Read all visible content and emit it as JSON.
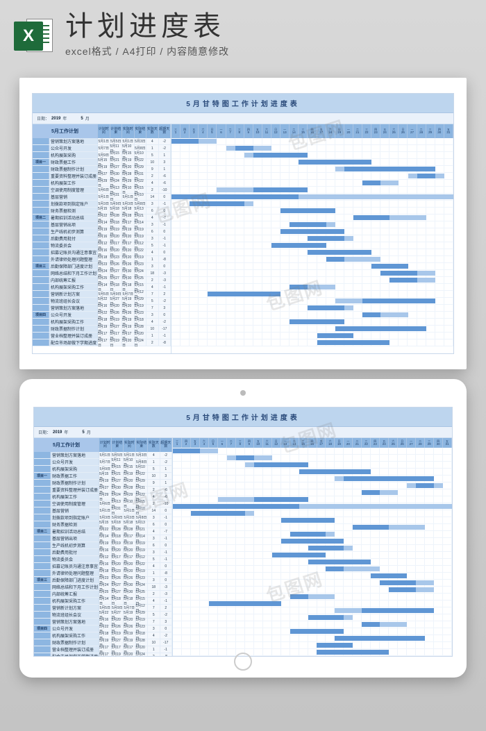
{
  "header": {
    "title": "计划进度表",
    "subtitle": "excel格式 / A4打印 / 内容随意修改",
    "icon_letter": "X"
  },
  "chart_data": {
    "type": "table",
    "title": "5月甘特图工作计划进度表",
    "date_label": "日期：",
    "year": "2019",
    "year_suffix": "年",
    "month": "5",
    "month_suffix": "月",
    "plan_heading": "5月工作计划",
    "columns": [
      "计划时间",
      "计划结束",
      "实际时间",
      "实际结束",
      "实际天数",
      "超期天数"
    ],
    "days": 31,
    "weekdays": [
      "三",
      "四",
      "五",
      "六",
      "日",
      "一",
      "二",
      "三",
      "四",
      "五",
      "六",
      "日",
      "一",
      "二",
      "三",
      "四",
      "五",
      "六",
      "日",
      "一",
      "二",
      "三",
      "四",
      "五",
      "六",
      "日",
      "一",
      "二",
      "三",
      "四",
      "五"
    ],
    "groups": [
      {
        "name": "项目一",
        "tasks": [
          {
            "name": "营销策划方案落地",
            "plan_start": "5月1日",
            "plan_end": "5月5日",
            "actual_start": "5月1日",
            "actual_end": "5月3日",
            "actual_days": 4,
            "over": -2,
            "bar_start": 1,
            "bar_len": 5,
            "abar_start": 1,
            "abar_len": 3
          },
          {
            "name": "公众号开发",
            "plan_start": "5月7日",
            "plan_end": "5月11日",
            "actual_start": "5月10日",
            "actual_end": "5月8日",
            "actual_days": 1,
            "over": -2,
            "bar_start": 7,
            "bar_len": 5,
            "abar_start": 8,
            "abar_len": 2
          },
          {
            "name": "机构展架采购",
            "plan_start": "5月9日",
            "plan_end": "5月15日",
            "actual_start": "5月15日",
            "actual_end": "5月10日",
            "actual_days": 5,
            "over": 1,
            "bar_start": 9,
            "bar_len": 7,
            "abar_start": 10,
            "abar_len": 6
          },
          {
            "name": "财政票据工作",
            "plan_start": "5月15日",
            "plan_end": "5月21日",
            "actual_start": "5月19日",
            "actual_end": "5月22日",
            "actual_days": 10,
            "over": 3,
            "bar_start": 15,
            "bar_len": 7,
            "abar_start": 15,
            "abar_len": 8
          },
          {
            "name": "财政票据制作计划",
            "plan_start": "5月19日",
            "plan_end": "5月27日",
            "actual_start": "5月20日",
            "actual_end": "5月29日",
            "actual_days": 9,
            "over": 1,
            "bar_start": 19,
            "bar_len": 9,
            "abar_start": 20,
            "abar_len": 10
          },
          {
            "name": "重要资料整理并装订成册",
            "plan_start": "5月27日",
            "plan_end": "5月30日",
            "actual_start": "5月28日",
            "actual_end": "5月31日",
            "actual_days": 2,
            "over": -6,
            "bar_start": 27,
            "bar_len": 4,
            "abar_start": 28,
            "abar_len": 2
          },
          {
            "name": "机构展架工作",
            "plan_start": "5月29日",
            "plan_end": "5月24日",
            "actual_start": "5月29日",
            "actual_end": "5月22日",
            "actual_days": 4,
            "over": -6,
            "bar_start": 22,
            "bar_len": 4,
            "abar_start": 22,
            "abar_len": 2
          }
        ]
      },
      {
        "name": "项目二",
        "tasks": [
          {
            "name": "空调使用制度管理",
            "plan_start": "5月6日",
            "plan_end": "5月13日",
            "actual_start": "5月10日",
            "actual_end": "5月15日",
            "actual_days": 2,
            "over": -10,
            "bar_start": 6,
            "bar_len": 8,
            "abar_start": 10,
            "abar_len": 6
          },
          {
            "name": "基层营销",
            "plan_start": "5月1日",
            "plan_end": "5月31日",
            "actual_start": "5月1日",
            "actual_end": "5月10日",
            "actual_days": 14,
            "over": 0,
            "bar_start": 1,
            "bar_len": 31,
            "abar_start": 1,
            "abar_len": 14
          },
          {
            "name": "划拨款项到指定账户",
            "plan_start": "5月3日",
            "plan_end": "5月9日",
            "actual_start": "5月3日",
            "actual_end": "5月8日",
            "actual_days": 3,
            "over": -1,
            "bar_start": 3,
            "bar_len": 7,
            "abar_start": 3,
            "abar_len": 6
          },
          {
            "name": "财务票据检测",
            "plan_start": "5月15日",
            "plan_end": "5月18日",
            "actual_start": "5月18日",
            "actual_end": "5月13日",
            "actual_days": 6,
            "over": 0,
            "bar_start": 13,
            "bar_len": 6,
            "abar_start": 13,
            "abar_len": 6
          },
          {
            "name": "暑期招训活动总结",
            "plan_start": "5月22日",
            "plan_end": "5月28日",
            "actual_start": "5月28日",
            "actual_end": "5月21日",
            "actual_days": 4,
            "over": -7,
            "bar_start": 21,
            "bar_len": 8,
            "abar_start": 21,
            "abar_len": 4
          },
          {
            "name": "基层营销出项",
            "plan_start": "5月14日",
            "plan_end": "5月18日",
            "actual_start": "5月17日",
            "actual_end": "5月14日",
            "actual_days": 3,
            "over": -1,
            "bar_start": 14,
            "bar_len": 5,
            "abar_start": 14,
            "abar_len": 4
          },
          {
            "name": "生产线机初步测算",
            "plan_start": "5月19日",
            "plan_end": "5月19日",
            "actual_start": "5月19日",
            "actual_end": "5月19日",
            "actual_days": 6,
            "over": 0,
            "bar_start": 13,
            "bar_len": 7,
            "abar_start": 13,
            "abar_len": 7
          },
          {
            "name": "后勤费用批付",
            "plan_start": "5月16日",
            "plan_end": "5月20日",
            "actual_start": "5月20日",
            "actual_end": "5月19日",
            "actual_days": 3,
            "over": -1,
            "bar_start": 16,
            "bar_len": 5,
            "abar_start": 16,
            "abar_len": 4
          }
        ]
      },
      {
        "name": "项目三",
        "tasks": [
          {
            "name": "物流委员会",
            "plan_start": "5月12日",
            "plan_end": "5月17日",
            "actual_start": "5月17日",
            "actual_end": "5月12日",
            "actual_days": 5,
            "over": -1,
            "bar_start": 12,
            "bar_len": 6,
            "abar_start": 12,
            "abar_len": 6
          },
          {
            "name": "招募记账员沟通注意事宜",
            "plan_start": "5月16日",
            "plan_end": "5月20日",
            "actual_start": "5月20日",
            "actual_end": "5月22日",
            "actual_days": 4,
            "over": 0,
            "bar_start": 16,
            "bar_len": 5,
            "abar_start": 16,
            "abar_len": 7
          },
          {
            "name": "外请律师处理问题整理",
            "plan_start": "5月18日",
            "plan_end": "5月23日",
            "actual_start": "5月20日",
            "actual_end": "5月19日",
            "actual_days": 1,
            "over": -8,
            "bar_start": 18,
            "bar_len": 6,
            "abar_start": 18,
            "abar_len": 2
          },
          {
            "name": "后勤保障部门进度计划",
            "plan_start": "5月23日",
            "plan_end": "5月26日",
            "actual_start": "5月26日",
            "actual_end": "5月23日",
            "actual_days": 3,
            "over": 0,
            "bar_start": 23,
            "bar_len": 4,
            "abar_start": 23,
            "abar_len": 4
          },
          {
            "name": "网络总结和下月工作计划",
            "plan_start": "5月24日",
            "plan_end": "5月27日",
            "actual_start": "5月30日",
            "actual_end": "5月24日",
            "actual_days": 18,
            "over": -3,
            "bar_start": 24,
            "bar_len": 6,
            "abar_start": 24,
            "abar_len": 4
          },
          {
            "name": "内部统筹汇报",
            "plan_start": "5月25日",
            "plan_end": "5月27日",
            "actual_start": "5月30日",
            "actual_end": "5月25日",
            "actual_days": 2,
            "over": -3,
            "bar_start": 25,
            "bar_len": 5,
            "abar_start": 25,
            "abar_len": 3
          }
        ]
      },
      {
        "name": "项目四",
        "tasks": [
          {
            "name": "机构展架采购工作",
            "plan_start": "5月14日",
            "plan_end": "5月18日",
            "actual_start": "5月18日",
            "actual_end": "5月15日",
            "actual_days": 4,
            "over": -1,
            "bar_start": 14,
            "bar_len": 5,
            "abar_start": 14,
            "abar_len": 2
          },
          {
            "name": "营销新计划方案",
            "plan_start": "5月5日",
            "plan_end": "5月9日",
            "actual_start": "5月7日",
            "actual_end": "5月12日",
            "actual_days": 7,
            "over": 2,
            "bar_start": 5,
            "bar_len": 5,
            "abar_start": 5,
            "abar_len": 8
          },
          {
            "name": "物流班组长会议",
            "plan_start": "5月22日",
            "plan_end": "5月27日",
            "actual_start": "5月19日",
            "actual_end": "5月29日",
            "actual_days": 5,
            "over": -2,
            "bar_start": 19,
            "bar_len": 9,
            "abar_start": 22,
            "abar_len": 8
          },
          {
            "name": "营销策划方案落地",
            "plan_start": "5月16日",
            "plan_end": "5月20日",
            "actual_start": "5月20日",
            "actual_end": "5月19日",
            "actual_days": 7,
            "over": 3,
            "bar_start": 16,
            "bar_len": 5,
            "abar_start": 16,
            "abar_len": 4
          },
          {
            "name": "公众号开发",
            "plan_start": "5月22日",
            "plan_end": "5月26日",
            "actual_start": "5月26日",
            "actual_end": "5月23日",
            "actual_days": 3,
            "over": 0,
            "bar_start": 22,
            "bar_len": 5,
            "abar_start": 22,
            "abar_len": 2
          },
          {
            "name": "机构展架采购工作",
            "plan_start": "5月18日",
            "plan_end": "5月19日",
            "actual_start": "5月19日",
            "actual_end": "5月18日",
            "actual_days": 4,
            "over": -2,
            "bar_start": 14,
            "bar_len": 6,
            "abar_start": 14,
            "abar_len": 6
          },
          {
            "name": "财政票据制作计划",
            "plan_start": "5月19日",
            "plan_end": "5月27日",
            "actual_start": "5月19日",
            "actual_end": "5月28日",
            "actual_days": 10,
            "over": -17,
            "bar_start": 19,
            "bar_len": 9,
            "abar_start": 19,
            "abar_len": 10
          },
          {
            "name": "营业档整理并装订成册",
            "plan_start": "5月17日",
            "plan_end": "5月17日",
            "actual_start": "5月17日",
            "actual_end": "5月20日",
            "actual_days": 1,
            "over": -1,
            "bar_start": 17,
            "bar_len": 1,
            "abar_start": 17,
            "abar_len": 4
          },
          {
            "name": "配合市场部做下学期进度计划",
            "plan_start": "5月17日",
            "plan_end": "5月19日",
            "actual_start": "5月20日",
            "actual_end": "5月24日",
            "actual_days": 2,
            "over": -8,
            "bar_start": 17,
            "bar_len": 3,
            "abar_start": 17,
            "abar_len": 8
          }
        ]
      }
    ]
  },
  "watermark": "包图网"
}
